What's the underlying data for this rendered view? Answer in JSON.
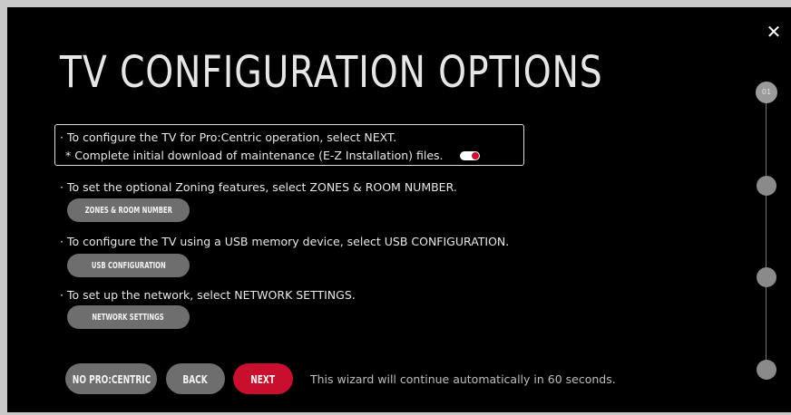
{
  "close": {
    "symbol": "✕"
  },
  "title": "TV CONFIGURATION OPTIONS",
  "highlight": {
    "line1": "· To configure the TV for Pro:Centric operation, select NEXT.",
    "line2": "* Complete initial download of maintenance (E-Z Installation) files.",
    "toggle_on": true
  },
  "zoning": {
    "text": "· To set the optional Zoning features, select ZONES & ROOM NUMBER.",
    "button": "ZONES & ROOM NUMBER"
  },
  "usb": {
    "text": "· To configure the TV using a USB memory device, select USB CONFIGURATION.",
    "button": "USB CONFIGURATION"
  },
  "network": {
    "text": "· To set up the network, select NETWORK SETTINGS.",
    "button": "NETWORK SETTINGS"
  },
  "footer": {
    "no_procentric": "NO PRO:CENTRIC",
    "back": "BACK",
    "next": "NEXT",
    "auto_message": "This wizard will continue automatically in 60 seconds."
  },
  "steps": {
    "current_label": "01"
  },
  "colors": {
    "accent": "#c8102e",
    "pill_gray": "#6e6e6e",
    "background": "#000000"
  }
}
